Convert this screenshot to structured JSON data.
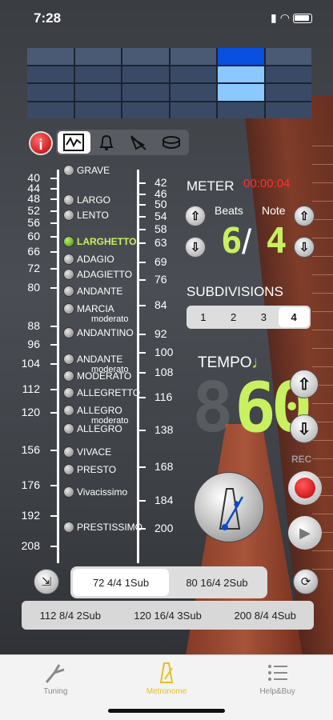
{
  "status": {
    "time": "7:28"
  },
  "mode_bar": {
    "info_label": "i"
  },
  "tempo_scale": {
    "left_numbers": [
      "40",
      "44",
      "48",
      "52",
      "56",
      "60",
      "66",
      "72",
      "80",
      "88",
      "96",
      "104",
      "112",
      "120",
      "156",
      "176",
      "192",
      "208"
    ],
    "right_numbers": [
      "42",
      "46",
      "50",
      "54",
      "58",
      "63",
      "69",
      "76",
      "84",
      "92",
      "100",
      "108",
      "116",
      "138",
      "168",
      "184",
      "200"
    ],
    "names": [
      {
        "label": "GRAVE",
        "sub": ""
      },
      {
        "label": "LARGO",
        "sub": ""
      },
      {
        "label": "LENTO",
        "sub": ""
      },
      {
        "label": "LARGHETTO",
        "sub": "",
        "selected": true
      },
      {
        "label": "ADAGIO",
        "sub": ""
      },
      {
        "label": "ADAGIETTO",
        "sub": ""
      },
      {
        "label": "ANDANTE",
        "sub": ""
      },
      {
        "label": "MARCIA",
        "sub": "moderato"
      },
      {
        "label": "ANDANTINO",
        "sub": ""
      },
      {
        "label": "ANDANTE",
        "sub": "moderato"
      },
      {
        "label": "MODERATO",
        "sub": ""
      },
      {
        "label": "ALLEGRETTO",
        "sub": ""
      },
      {
        "label": "ALLEGRO",
        "sub": "moderato"
      },
      {
        "label": "ALLEGRO",
        "sub": ""
      },
      {
        "label": "VIVACE",
        "sub": ""
      },
      {
        "label": "PRESTO",
        "sub": ""
      },
      {
        "label": "Vivacissimo",
        "sub": ""
      },
      {
        "label": "PRESTISSIMO",
        "sub": ""
      }
    ]
  },
  "meter": {
    "title": "METER",
    "timer": "00:00:04",
    "beats_label": "Beats",
    "note_label": "Note",
    "beats_value": "6",
    "slash": "/",
    "note_value": "4"
  },
  "subdivisions": {
    "title": "SUBDIVISIONS",
    "options": [
      "1",
      "2",
      "3",
      "4"
    ],
    "selected": "4"
  },
  "tempo": {
    "title": "TEMPO",
    "digits_ghost": "8",
    "digits": "60"
  },
  "rec_label": "REC",
  "presets": {
    "top": [
      "72 4/4 1Sub",
      "80 16/4 2Sub"
    ],
    "top_selected": 0,
    "bottom": [
      "112 8/4 2Sub",
      "120 16/4 3Sub",
      "200 8/4 4Sub"
    ]
  },
  "tabs": [
    {
      "label": "Tuning",
      "icon": "tuning-fork-icon"
    },
    {
      "label": "Metronome",
      "icon": "metronome-icon",
      "active": true
    },
    {
      "label": "Help&Buy",
      "icon": "list-icon"
    }
  ],
  "colors": {
    "accent_green": "#c8f060",
    "grid_accent": "#0a50e0",
    "grid_light": "#8ac8ff",
    "timer_red": "#ff3030",
    "tab_active": "#e8c020"
  }
}
